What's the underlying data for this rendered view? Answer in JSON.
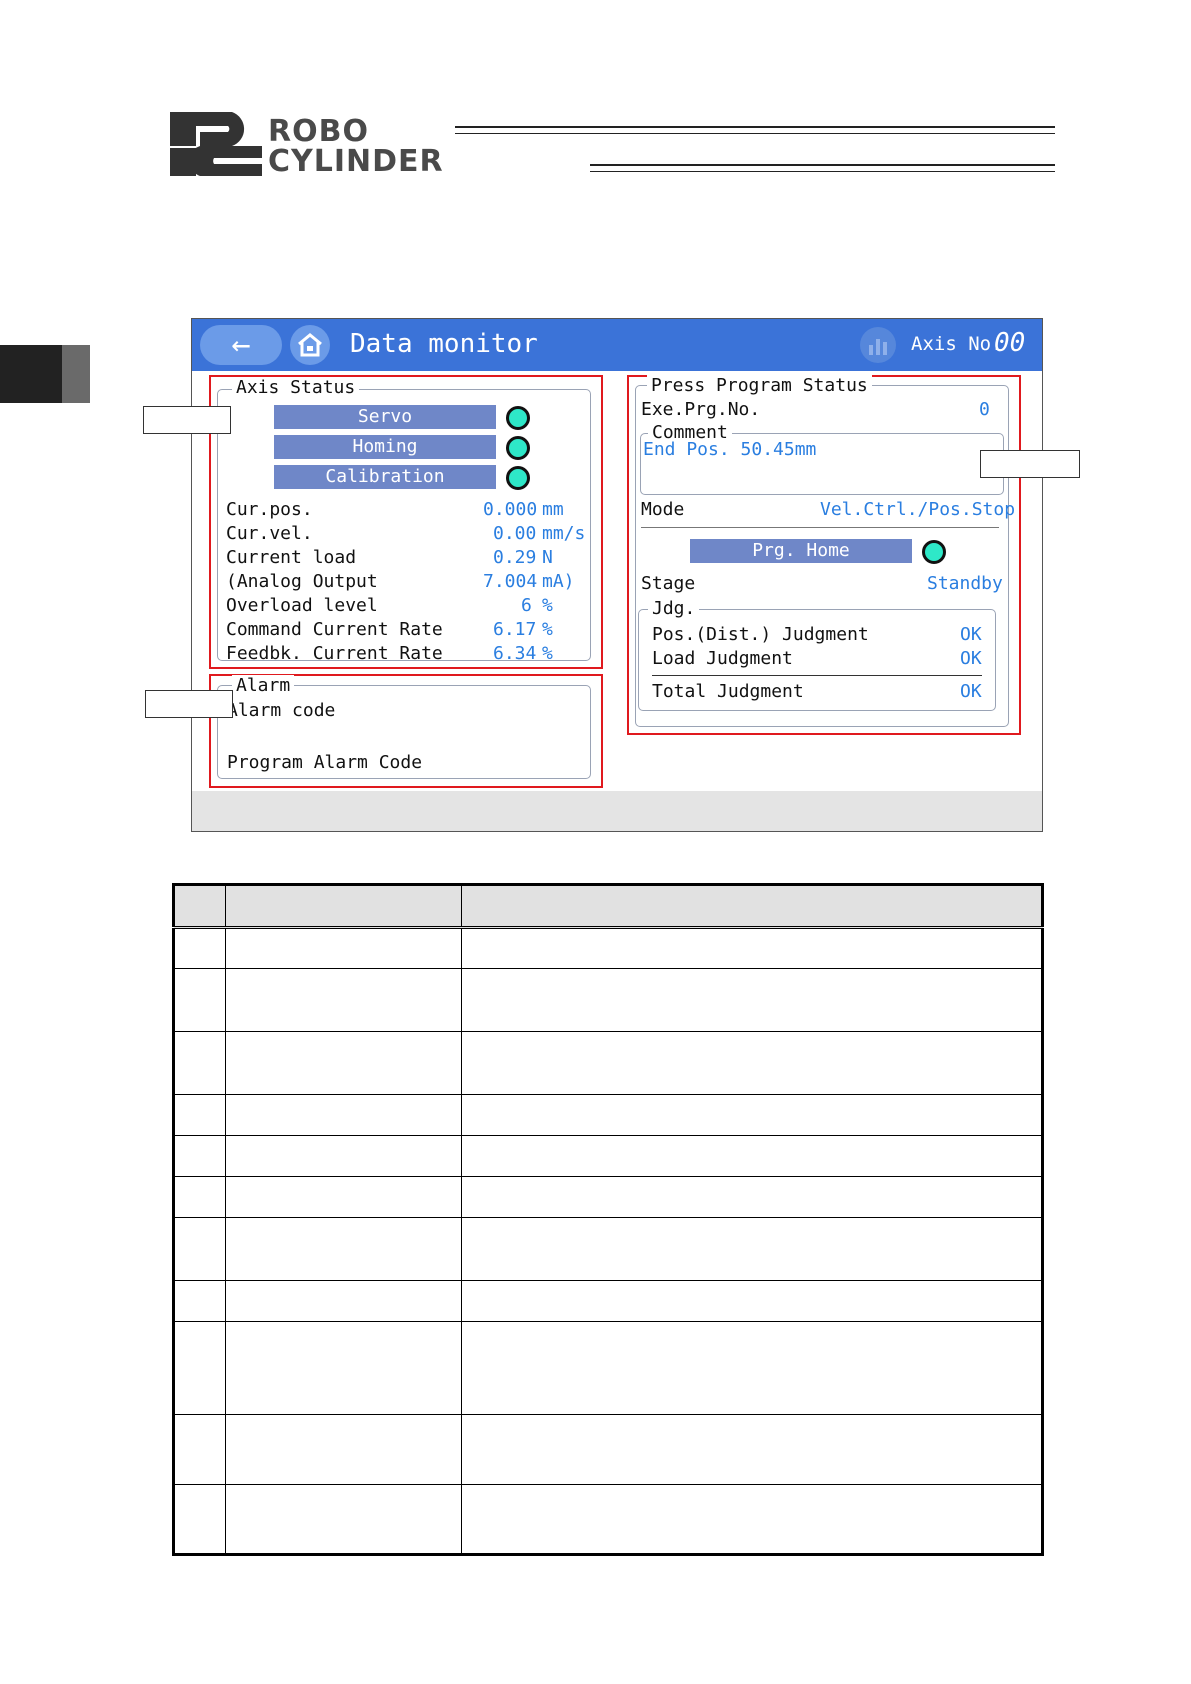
{
  "logo": {
    "mark": "RC",
    "line1": "ROBO",
    "line2": "CYLINDER"
  },
  "screen": {
    "back_icon": "arrow-left-icon",
    "home_icon": "home-icon",
    "title": "Data monitor",
    "chart_icon": "bar-chart-icon",
    "axis_label": "Axis No.",
    "axis_value": "00"
  },
  "axis_status": {
    "title": "Axis Status",
    "indicators": [
      {
        "label": "Servo"
      },
      {
        "label": "Homing"
      },
      {
        "label": "Calibration"
      }
    ],
    "rows": [
      {
        "label": "Cur.pos.",
        "value": "0.000",
        "unit": "mm"
      },
      {
        "label": "Cur.vel.",
        "value": "0.00",
        "unit": "mm/s"
      },
      {
        "label": "Current load",
        "value": "0.29",
        "unit": "N"
      },
      {
        "label": "(Analog Output",
        "value": "7.004",
        "unit": "mA)"
      },
      {
        "label": "Overload level",
        "value": "6",
        "unit": "%"
      },
      {
        "label": "Command Current Rate",
        "value": "6.17",
        "unit": "%"
      },
      {
        "label": "Feedbk. Current Rate",
        "value": "6.34",
        "unit": "%"
      }
    ]
  },
  "alarm": {
    "title": "Alarm",
    "alarm_code_label": "Alarm code",
    "program_alarm_label": "Program Alarm Code"
  },
  "press_program": {
    "title": "Press Program Status",
    "exe_label": "Exe.Prg.No.",
    "exe_value": "0",
    "comment_title": "Comment",
    "comment_text": "End Pos. 50.45mm",
    "mode_label": "Mode",
    "mode_value": "Vel.Ctrl./Pos.Stop",
    "prg_home_label": "Prg. Home",
    "stage_label": "Stage",
    "stage_value": "Standby",
    "jdg_title": "Jdg.",
    "judgments": [
      {
        "label": "Pos.(Dist.) Judgment",
        "value": "OK"
      },
      {
        "label": "Load Judgment",
        "value": "OK"
      },
      {
        "label": "Total Judgment",
        "value": "OK"
      }
    ]
  },
  "table": {
    "header": [
      "",
      "",
      ""
    ],
    "row_count": 11
  }
}
